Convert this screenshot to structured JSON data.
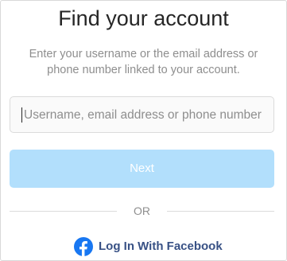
{
  "header": {
    "title": "Find your account",
    "subtitle": "Enter your username or the email address or phone number linked to your account."
  },
  "form": {
    "identifier_placeholder": "Username, email address or phone number",
    "identifier_value": "",
    "next_label": "Next",
    "next_enabled": false
  },
  "divider": {
    "label": "OR"
  },
  "facebook": {
    "label": "Log In With Facebook",
    "icon": "facebook-icon"
  },
  "colors": {
    "button_disabled": "#b2dffc",
    "facebook_text": "#385185",
    "facebook_icon": "#1877f2",
    "muted_text": "#8e8e8e",
    "title_text": "#262626"
  }
}
